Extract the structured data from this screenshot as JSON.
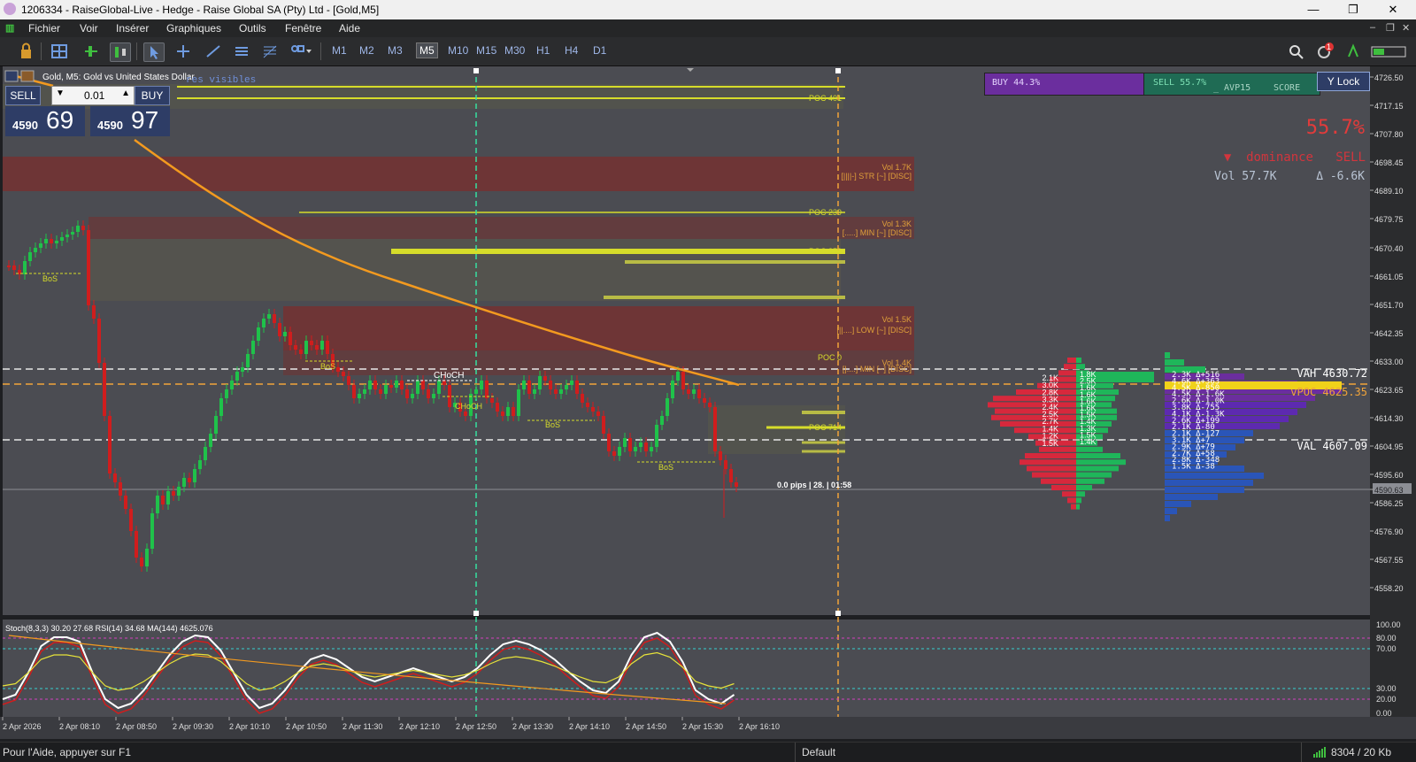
{
  "window": {
    "title": "1206334 - RaiseGlobal-Live - Hedge - Raise Global SA (Pty) Ltd - [Gold,M5]",
    "buttons": [
      "—",
      "❐",
      "✕"
    ]
  },
  "menu": {
    "items": [
      "Fichier",
      "Voir",
      "Insérer",
      "Graphiques",
      "Outils",
      "Fenêtre",
      "Aide"
    ],
    "mdi_buttons": [
      "–",
      "❐",
      "✕"
    ]
  },
  "toolbar": {
    "timeframes": [
      "M1",
      "M2",
      "M3",
      "M5",
      "M10",
      "M15",
      "M30",
      "H1",
      "H4",
      "D1"
    ],
    "active_timeframe": "M5",
    "notification_count": "1"
  },
  "chart": {
    "symbol_label": "Gold, M5:  Gold vs United States Dollar",
    "faded_text": "res visibles",
    "indicator_label": "Stoch(8,3,3) 30.20 27.68 RSI(14) 34.68 MA(144) 4625.076",
    "cursor_info": "0.0 pips | 28. | 01:58",
    "price_labels": [
      "4726.50",
      "4717.15",
      "4707.80",
      "4698.45",
      "4689.10",
      "4679.75",
      "4670.40",
      "4661.05",
      "4651.70",
      "4642.35",
      "4633.00",
      "4623.65",
      "4614.30",
      "4604.95",
      "4595.60",
      "4590.63",
      "4586.25",
      "4576.90",
      "4567.55",
      "4558.20"
    ],
    "current_price_label": "4590.63",
    "osc_labels": [
      "100.00",
      "80.00",
      "70.00",
      "30.00",
      "20.00",
      "0.00"
    ],
    "time_labels": [
      "2 Apr 2026",
      "2 Apr 08:10",
      "2 Apr 08:50",
      "2 Apr 09:30",
      "2 Apr 10:10",
      "2 Apr 10:50",
      "2 Apr 11:30",
      "2 Apr 12:10",
      "2 Apr 12:50",
      "2 Apr 13:30",
      "2 Apr 14:10",
      "2 Apr 14:50",
      "2 Apr 15:30",
      "2 Apr 16:10"
    ],
    "structure_labels": [
      "BoS",
      "BoS",
      "CHoCH",
      "CHoCH",
      "BoS",
      "BoS"
    ],
    "poc_labels": [
      "POC 401",
      "POC 239",
      "POC 850",
      "POC 0",
      "POC 714"
    ],
    "zone_labels": [
      {
        "vol": "Vol 1.7K",
        "desc": "[||||-] STR [~] [DISC]"
      },
      {
        "vol": "Vol 1.3K",
        "desc": "[.....] MIN [~] [DISC]"
      },
      {
        "vol": "Vol 1.5K",
        "desc": "[||....] LOW [~] [DISC]"
      },
      {
        "vol": "Vol 1.4K",
        "desc": "[|....] MIN [~] [DISC]"
      }
    ],
    "colors": {
      "bull": "#1fc24a",
      "bear": "#d01d1d",
      "bg": "#4b4c52",
      "ma": "#f39a1f",
      "poc": "#d6dc2a",
      "zone": "#7a2e2e"
    }
  },
  "trade_panel": {
    "sell_label": "SELL",
    "buy_label": "BUY",
    "lot": "0.01",
    "sell_price_small": "4590",
    "sell_price_big": "69",
    "buy_price_small": "4590",
    "buy_price_big": "97"
  },
  "dominance": {
    "buy_text": "BUY  44.3%",
    "sell_text": "SELL  55.7%",
    "avp": "_ AVP15",
    "score": "SCORE",
    "lock_button": "Y Lock",
    "big_percent": "55.7%",
    "dominance_label": "▼  dominance   SELL",
    "volume": "Vol 57.7K",
    "delta": "Δ -6.6K"
  },
  "volume_profile": {
    "vah_label": "VAH 4630.72",
    "vpoc_label": "vPOC 4625.35",
    "val_label": "VAL 4607.09",
    "left_labels": [
      "2.1K",
      "3.0K",
      "2.8K",
      "3.3K",
      "2.4K",
      "2.5K",
      "2.7K",
      "1.4K",
      "1.2K",
      "1.5K"
    ],
    "mid_labels": [
      "1.8K",
      "2.5K",
      "1.6K",
      "1.6K",
      "1.6K",
      "1.6K",
      "1.5K",
      "1.4K",
      "1.3K",
      "1.5K",
      "1.4K"
    ],
    "delta_labels": [
      "2.3K  Δ+516",
      "4.6K  Δ+363",
      "4.5K  Δ-850",
      "4.5K  Δ-1.6K",
      "2.6K  Δ-1.0K",
      "3.8K  Δ-755",
      "4.1K  Δ-1.3K",
      "2.6K  Δ+199",
      "2.1K  Δ-80",
      "2.1K  Δ-127",
      "3.1K  Δ+7",
      "2.9K  Δ+79",
      "2.7K  Δ+58",
      "2.8K  Δ-348",
      "1.5K  Δ-38"
    ]
  },
  "status": {
    "help": "Pour l'Aide, appuyer sur F1",
    "profile": "Default",
    "connection": "8304 / 20 Kb"
  }
}
